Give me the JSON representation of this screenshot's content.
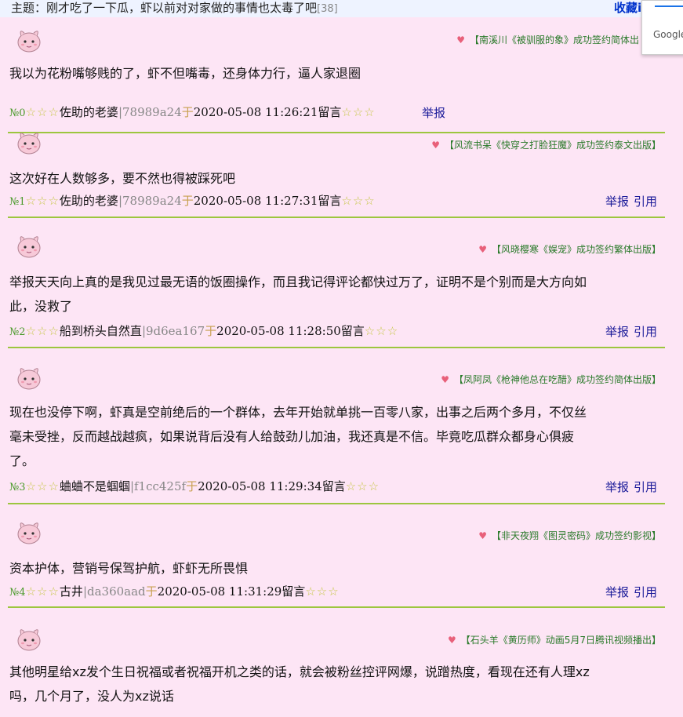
{
  "topic": {
    "text": "主题：刚才吃了一下瓜，虾以前对对家做的事情也太毒了吧",
    "count": "[38]",
    "fav": "收藏i"
  },
  "google_popup": {
    "text": "Google"
  },
  "colors": {
    "background": "#fde5f5",
    "divider": "#9cc63e",
    "link": "#1a1a99",
    "sign": "#2a7a2a",
    "heart": "#e8607a"
  },
  "icons": {
    "avatar": "pink-cartoon-avatar-icon",
    "heart": "heart-icon",
    "star": "star-icon"
  },
  "report_label": "举报",
  "quote_label": "引用",
  "posts": [
    {
      "sign": "【南溪川《被驯服的象》成功签约简体出",
      "content": [
        "我以为花粉嘴够贱的了，虾不但嘴毒，还身体力行，逼人家退圈"
      ],
      "no": "№0",
      "nick": "佐助的老婆",
      "uid": "|78989a24",
      "yu": "于",
      "time": "2020-05-08 11:26:21",
      "ly": "留言"
    },
    {
      "sign": "【风流书呆《快穿之打脸狂魔》成功签约泰文出版】",
      "content": [
        "这次好在人数够多，要不然也得被踩死吧"
      ],
      "no": "№1",
      "nick": "佐助的老婆",
      "uid": "|78989a24",
      "yu": "于",
      "time": "2020-05-08 11:27:31",
      "ly": "留言"
    },
    {
      "sign": "【风晓樱寒《娱宠》成功签约繁体出版】",
      "content": [
        "举报天天向上真的是我见过最无语的饭圈操作，而且我记得评论都快过万了，证明不是个别而是大方向如",
        "此，没救了"
      ],
      "no": "№2",
      "nick": "船到桥头自然直",
      "uid": "|9d6ea167",
      "yu": "于",
      "time": "2020-05-08 11:28:50",
      "ly": "留言"
    },
    {
      "sign": "【凤阿凤《枪神他总在吃醋》成功签约简体出版】",
      "content": [
        "现在也没停下啊，虾真是空前绝后的一个群体，去年开始就单挑一百零八家，出事之后两个多月，不仅丝",
        "毫未受挫，反而越战越疯，如果说背后没有人给鼓劲儿加油，我还真是不信。毕竟吃瓜群众都身心俱疲",
        "了。"
      ],
      "no": "№3",
      "nick": "蛐蛐不是蝈蝈",
      "uid": "|f1cc425f",
      "yu": "于",
      "time": "2020-05-08 11:29:34",
      "ly": "留言"
    },
    {
      "sign": "【非天夜翔《图灵密码》成功签约影视】",
      "content": [
        "资本护体，营销号保驾护航，虾虾无所畏惧"
      ],
      "no": "№4",
      "nick": "古井",
      "uid": "|da360aad",
      "yu": "于",
      "time": "2020-05-08 11:31:29",
      "ly": "留言"
    },
    {
      "sign": "【石头羊《黄历师》动画5月7日腾讯视频播出】",
      "content": [
        "其他明星给xz发个生日祝福或者祝福开机之类的话，就会被粉丝控评网爆，说蹭热度，看现在还有人理xz",
        "吗，几个月了，没人为xz说话"
      ],
      "no": "",
      "nick": "",
      "uid": "",
      "yu": "",
      "time": "",
      "ly": ""
    }
  ]
}
